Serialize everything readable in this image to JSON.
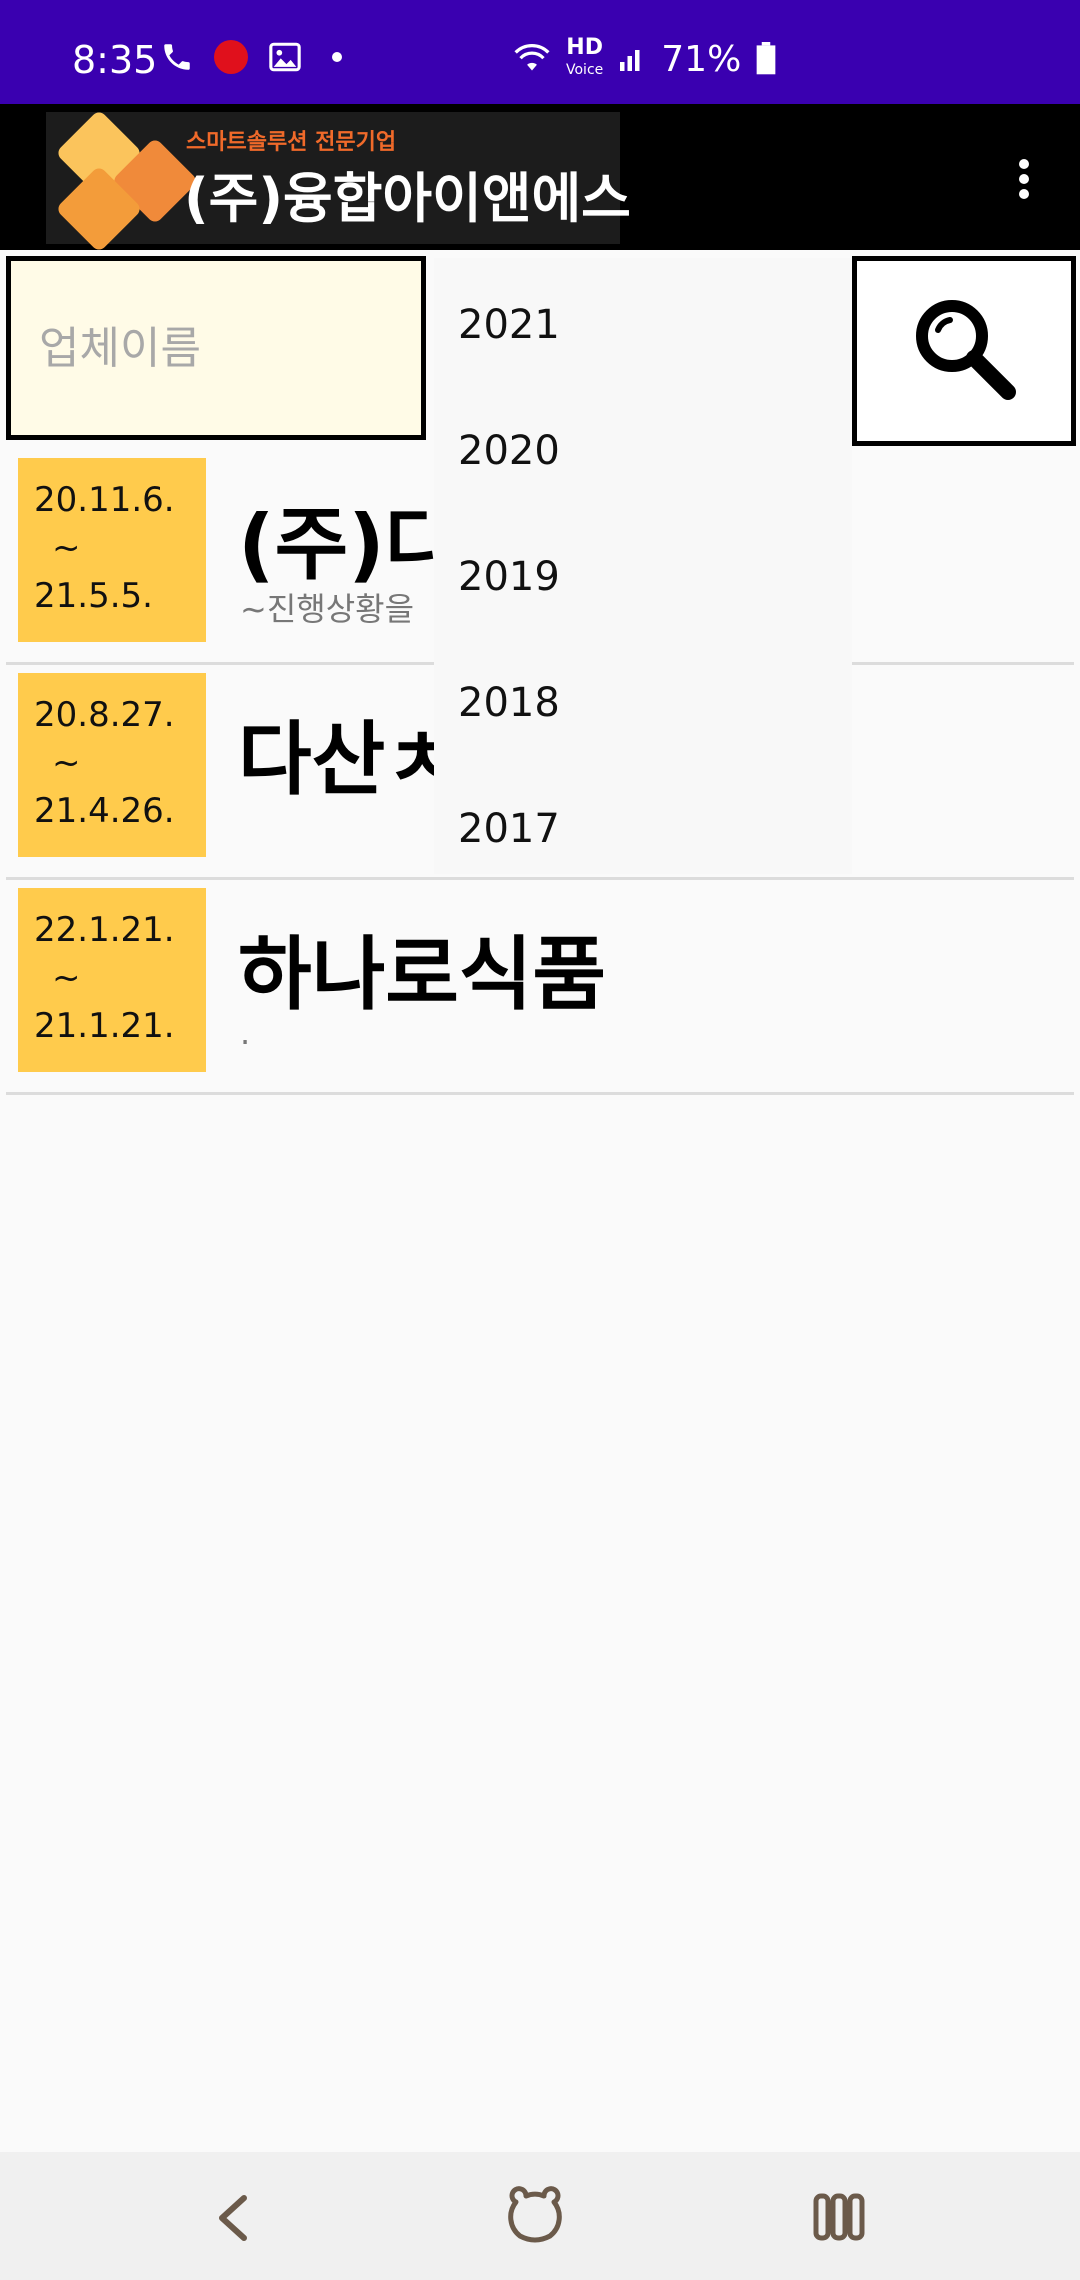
{
  "status_bar": {
    "time": "8:35",
    "network": "HD",
    "network_sub": "Voice",
    "battery": "71%"
  },
  "app_bar": {
    "logo_slogan": "스마트솔루션 전문기업",
    "logo_company": "(주)융합아이앤에스"
  },
  "search": {
    "placeholder": "업체이름"
  },
  "year_dropdown": {
    "options": [
      "2021",
      "2020",
      "2019",
      "2018",
      "2017"
    ]
  },
  "list": [
    {
      "date_start": "20.11.6.",
      "tilde": "~",
      "date_end": "21.5.5.",
      "name": "(주)다",
      "sub": "~진행상황을"
    },
    {
      "date_start": "20.8.27.",
      "tilde": "~",
      "date_end": "21.4.26.",
      "name": "다산ㅊ",
      "sub": ""
    },
    {
      "date_start": "22.1.21.",
      "tilde": "~",
      "date_end": "21.1.21.",
      "name": "하나로식품",
      "sub": "."
    }
  ],
  "colors": {
    "status_bar": "#3a00b0",
    "date_badge": "#ffcb4c",
    "search_bg": "#fffbe7"
  },
  "icons": {
    "search": "magnifier-icon",
    "more": "more-vert-icon",
    "back": "back-chevron-icon",
    "home": "home-bear-icon",
    "recents": "recents-icon"
  }
}
